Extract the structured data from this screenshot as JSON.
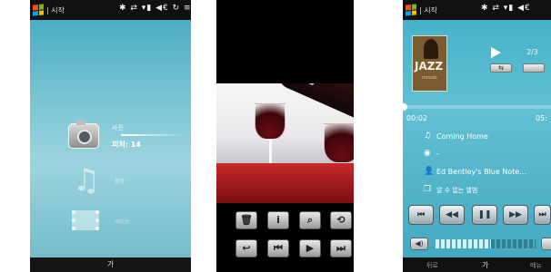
{
  "phone1": {
    "statusbar": {
      "start_label": "| 시작",
      "icons": "✱ ⇄ ▾▮ ◀€ ↻ ≡"
    },
    "photo_item": {
      "title": "사진",
      "count": "피처: 14"
    },
    "music_item": {
      "label": "음악"
    },
    "video_item": {
      "label": "비디오"
    },
    "bottom_bar": {
      "center": "가"
    }
  },
  "phone2": {
    "toolbar_row1": [
      "🗑",
      "i",
      "⌕",
      "⟲"
    ],
    "toolbar_row2": [
      "↩",
      "⏮",
      "▶",
      "⏭"
    ]
  },
  "phone3": {
    "statusbar": {
      "start_label": "| 시작",
      "icons": "✱ ⇄ ▾▮ ◀€"
    },
    "album_art": {
      "title": "JAZZ",
      "subtitle": "moods"
    },
    "track_number": "2/3",
    "time": {
      "elapsed": "00:02",
      "total": "05:"
    },
    "song": "Coming Home",
    "sub_line": "-",
    "artist": "Ed Bentley's Blue Note...",
    "album": "알 수 없는 앨범",
    "controls": [
      "⏮",
      "◀◀",
      "❚❚",
      "▶▶",
      "⏭"
    ],
    "volume_level": 0.55,
    "bottom_bar": {
      "left": "뒤로",
      "center": "가",
      "right": "메뉴"
    }
  }
}
